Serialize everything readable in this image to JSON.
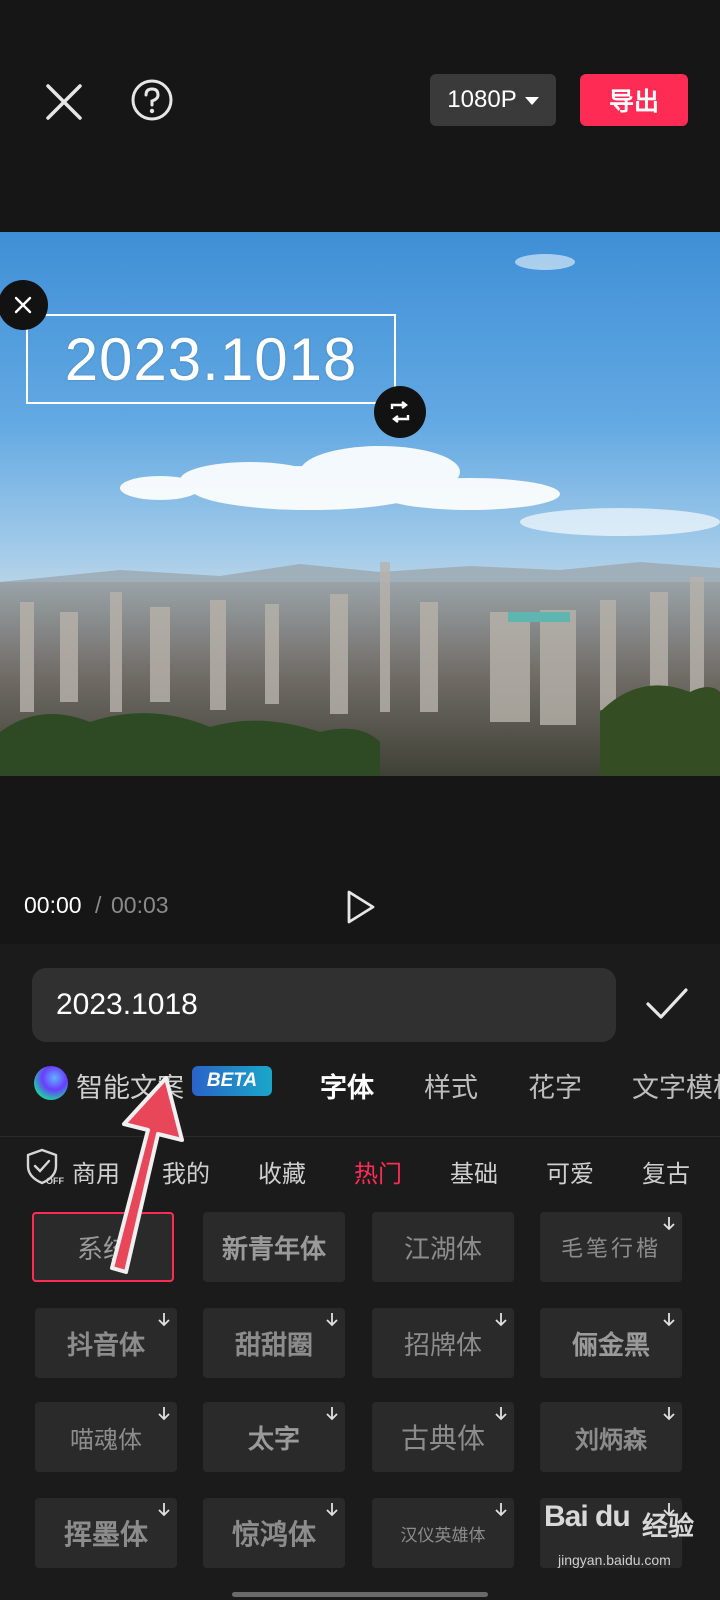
{
  "header": {
    "resolution_label": "1080P",
    "export_label": "导出"
  },
  "preview": {
    "overlay_text": "2023.1018"
  },
  "playback": {
    "current_time": "00:00",
    "separator": "/",
    "total_time": "00:03"
  },
  "editor": {
    "text_value": "2023.1018",
    "ai_label": "智能文案",
    "beta_badge": "BETA",
    "tabs": [
      {
        "label": "字体",
        "active": true
      },
      {
        "label": "样式",
        "active": false
      },
      {
        "label": "花字",
        "active": false
      },
      {
        "label": "文字模板",
        "active": false
      }
    ],
    "categories": [
      {
        "label": "商用",
        "active": false
      },
      {
        "label": "我的",
        "active": false
      },
      {
        "label": "收藏",
        "active": false
      },
      {
        "label": "热门",
        "active": true
      },
      {
        "label": "基础",
        "active": false
      },
      {
        "label": "可爱",
        "active": false
      },
      {
        "label": "复古",
        "active": false
      }
    ],
    "fonts": [
      {
        "label": "系统",
        "selected": true,
        "download": false
      },
      {
        "label": "新青年体",
        "selected": false,
        "download": false
      },
      {
        "label": "江湖体",
        "selected": false,
        "download": false
      },
      {
        "label": "毛笔行楷",
        "selected": false,
        "download": true
      },
      {
        "label": "抖音体",
        "selected": false,
        "download": true
      },
      {
        "label": "甜甜圈",
        "selected": false,
        "download": true
      },
      {
        "label": "招牌体",
        "selected": false,
        "download": true
      },
      {
        "label": "俪金黑",
        "selected": false,
        "download": true
      },
      {
        "label": "喵魂体",
        "selected": false,
        "download": true
      },
      {
        "label": "太字",
        "selected": false,
        "download": true
      },
      {
        "label": "古典体",
        "selected": false,
        "download": true
      },
      {
        "label": "刘炳森",
        "selected": false,
        "download": true
      },
      {
        "label": "挥墨体",
        "selected": false,
        "download": true
      },
      {
        "label": "惊鸿体",
        "selected": false,
        "download": true
      },
      {
        "label": "汉仪英雄体",
        "selected": false,
        "download": true
      },
      {
        "label": "",
        "selected": false,
        "download": true
      }
    ]
  },
  "watermark": {
    "logo": "Bai du",
    "zh": "经验",
    "url": "jingyan.baidu.com"
  },
  "colors": {
    "accent": "#fe2c55",
    "background": "#161616",
    "panel": "#1b1b1b",
    "tile": "#2a2a2a",
    "arrow": "#e8475a"
  }
}
